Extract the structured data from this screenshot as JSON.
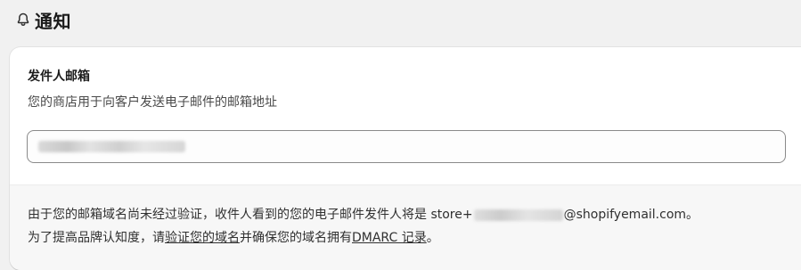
{
  "header": {
    "title": "通知",
    "icon": "bell-icon"
  },
  "sender_email": {
    "title": "发件人邮箱",
    "description": "您的商店用于向客户发送电子邮件的邮箱地址",
    "field_value": ""
  },
  "notice": {
    "line1_prefix": "由于您的邮箱域名尚未经过验证，收件人看到的您的电子邮件发件人将是 store+",
    "line1_suffix": "@shopifyemail.com。",
    "line2_prefix": "为了提高品牌认知度，请",
    "verify_link": "验证您的域名",
    "line2_middle": "并确保您的域名拥有",
    "dmarc_link": "DMARC 记录",
    "line2_suffix": "。"
  }
}
